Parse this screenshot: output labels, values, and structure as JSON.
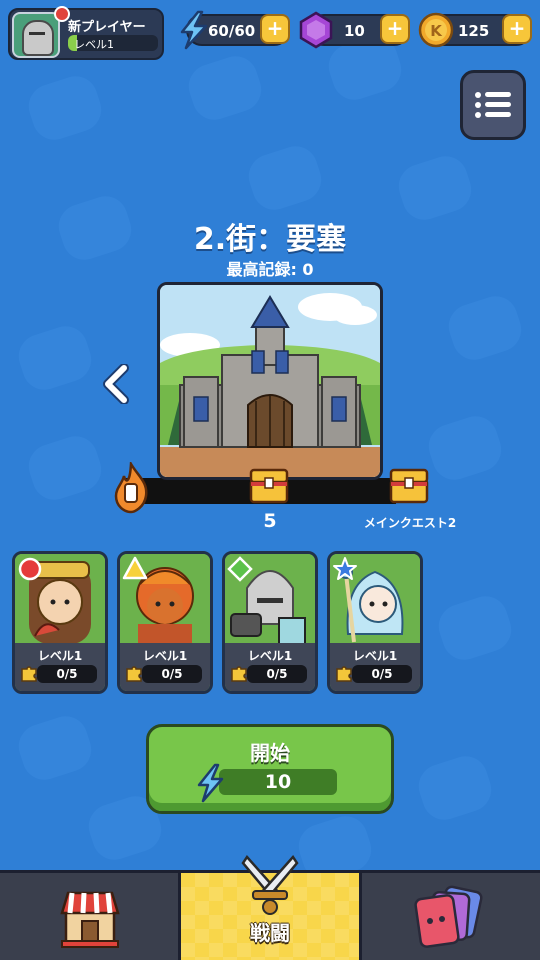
{
  "player": {
    "name": "新プレイヤー",
    "level": "レベル1",
    "level_progress": 0.1
  },
  "resources": {
    "energy": "60/60",
    "gems": "10",
    "coins": "125"
  },
  "stage": {
    "title": "2.街：要塞",
    "best_record": "最高記録: 0",
    "milestones": [
      {
        "label": "5"
      },
      {
        "label": "メインクエスト2"
      }
    ]
  },
  "heroes": [
    {
      "badge": "red-circle",
      "level": "レベル1",
      "shards": "0/5"
    },
    {
      "badge": "yellow-triangle",
      "level": "レベル1",
      "shards": "0/5"
    },
    {
      "badge": "green-diamond",
      "level": "レベル1",
      "shards": "0/5"
    },
    {
      "badge": "blue-star",
      "level": "レベル1",
      "shards": "0/5"
    }
  ],
  "start_button": {
    "label": "開始",
    "cost": "10"
  },
  "nav": {
    "battle_label": "戦闘"
  },
  "colors": {
    "background": "#2f7fd6",
    "accent_green": "#78c64a",
    "nav_active": "#f8d64a"
  }
}
